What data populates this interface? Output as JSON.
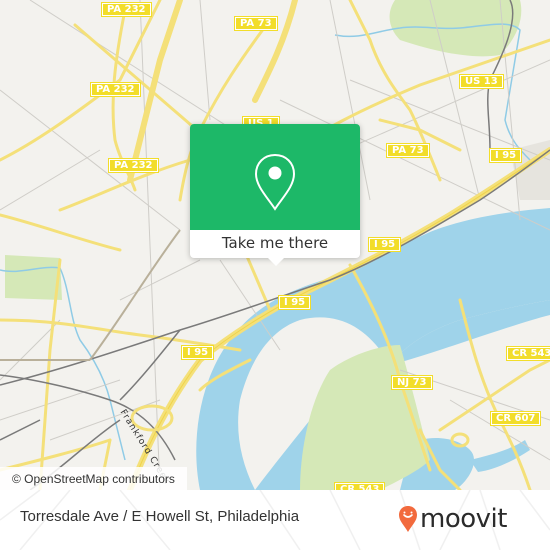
{
  "map": {
    "colors": {
      "background": "#f3f2ee",
      "water": "#9fd3ea",
      "park": "#d5e8b7",
      "major_road": "#f4e079",
      "minor_road": "#c9c8c4",
      "rail": "#7a7a7a",
      "shield": "#f2dd2a"
    },
    "road_shields": [
      {
        "label": "PA 232"
      },
      {
        "label": "PA 73"
      },
      {
        "label": "PA 232"
      },
      {
        "label": "US 1"
      },
      {
        "label": "US 13"
      },
      {
        "label": "PA 232"
      },
      {
        "label": "PA 73"
      },
      {
        "label": "I 95"
      },
      {
        "label": "I 95"
      },
      {
        "label": "I 95"
      },
      {
        "label": "I 95"
      },
      {
        "label": "CR 543"
      },
      {
        "label": "NJ 73"
      },
      {
        "label": "CR 607"
      },
      {
        "label": "CR 543"
      }
    ],
    "water_label": "Frankford Creek"
  },
  "popup": {
    "icon": "location-pin-icon",
    "button_label": "Take me there",
    "color": "#1db868"
  },
  "attribution": "© OpenStreetMap contributors",
  "footer": {
    "address": "Torresdale Ave / E Howell St, Philadelphia",
    "brand": "moovit",
    "brand_color": "#f26a3d"
  }
}
